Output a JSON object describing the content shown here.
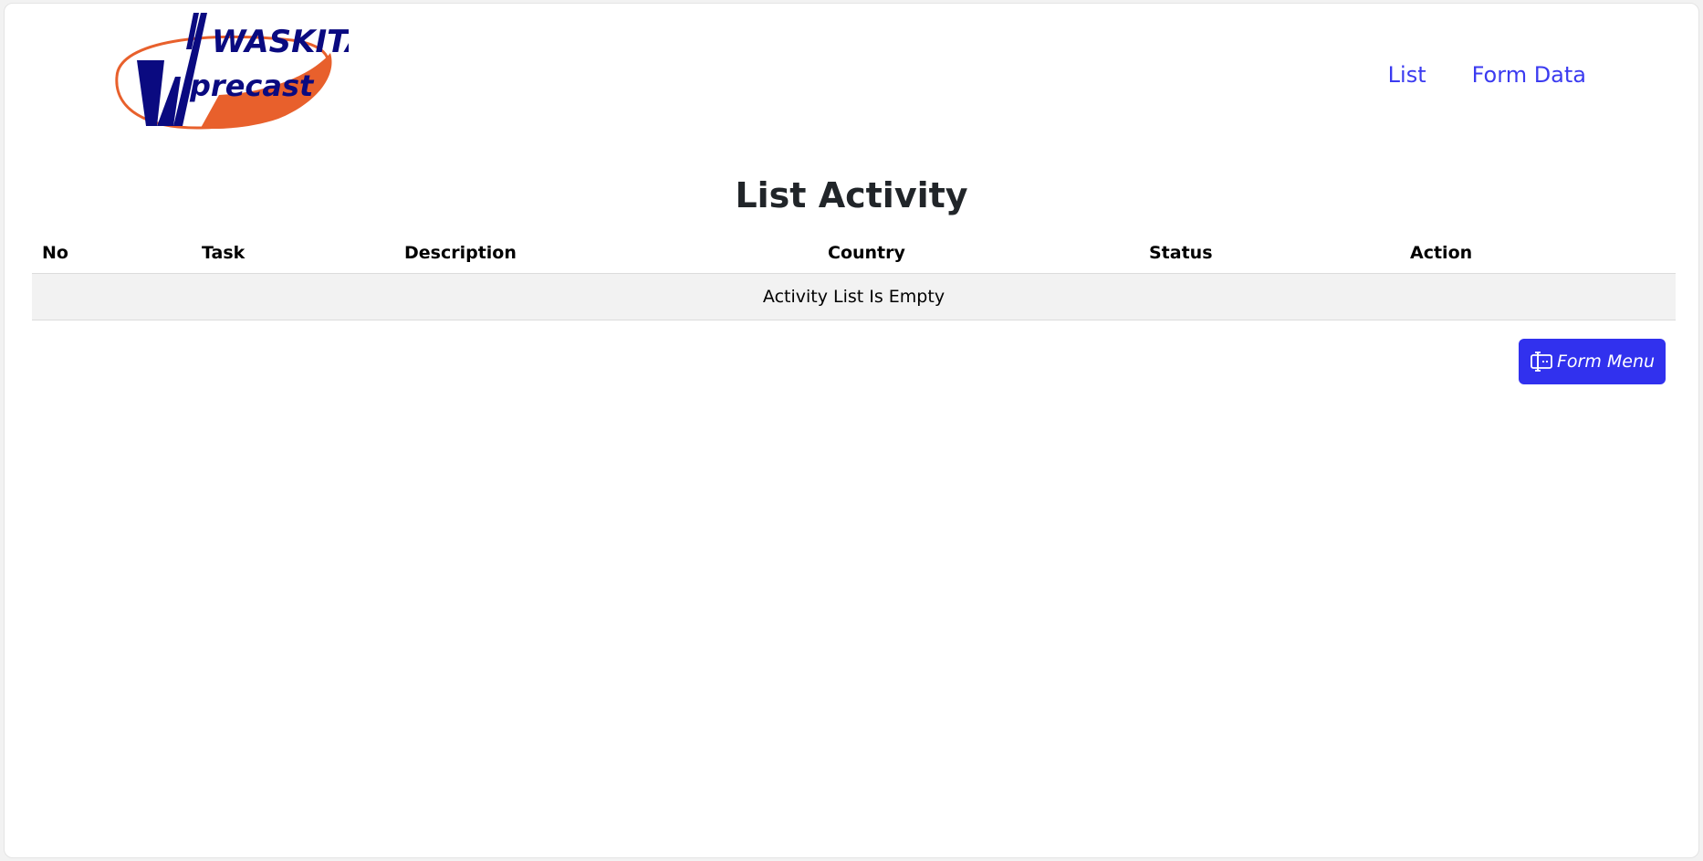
{
  "header": {
    "logo": {
      "name": "waskita-precast-logo",
      "text_top": "WASKITA",
      "text_bottom": "precast",
      "colors": {
        "navy": "#0a0a80",
        "orange": "#e8602c"
      }
    },
    "nav": [
      {
        "label": "List"
      },
      {
        "label": "Form Data"
      }
    ],
    "link_color": "#3b3bf0"
  },
  "main": {
    "title": "List Activity",
    "table": {
      "columns": [
        "No",
        "Task",
        "Description",
        "Country",
        "Status",
        "Action"
      ],
      "empty_message": "Activity List Is Empty"
    },
    "form_menu_button": {
      "label": "Form Menu",
      "icon": "form-icon",
      "color": "#3131ee"
    }
  }
}
